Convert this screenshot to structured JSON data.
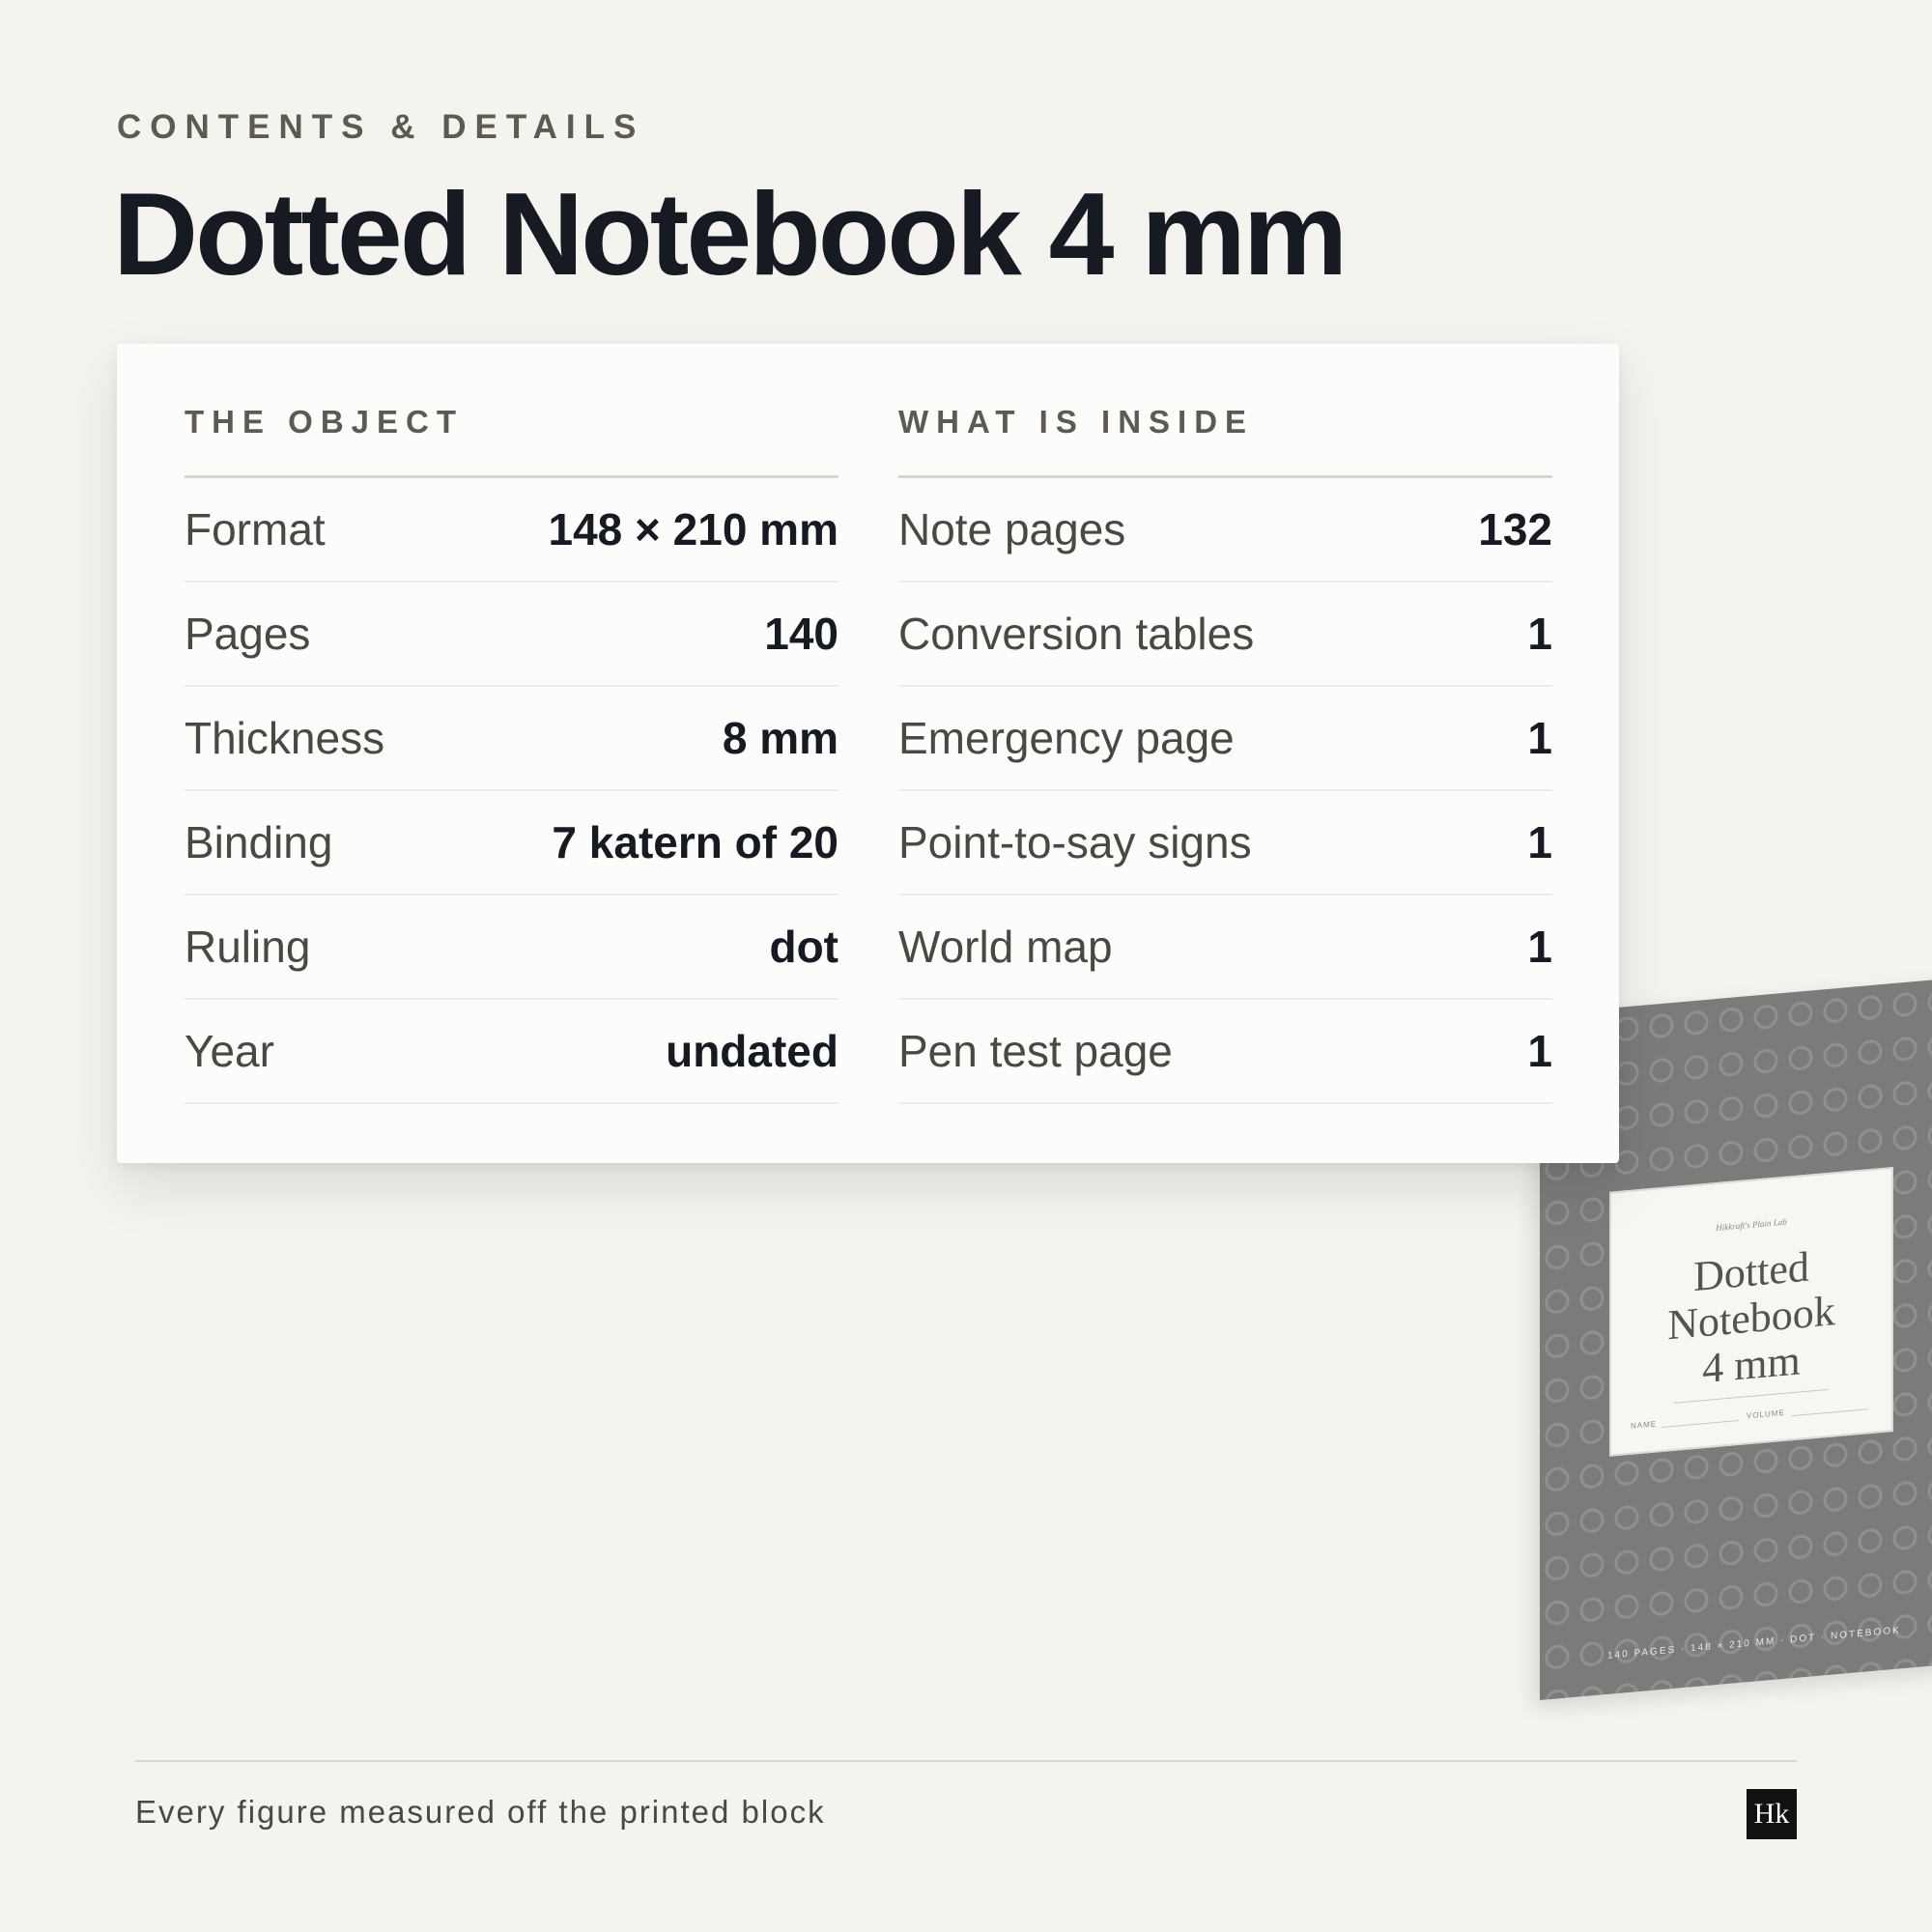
{
  "header": {
    "eyebrow": "CONTENTS & DETAILS",
    "title": "Dotted Notebook 4 mm"
  },
  "card": {
    "left_heading": "THE OBJECT",
    "right_heading": "WHAT IS INSIDE",
    "left_rows": [
      {
        "label": "Format",
        "value": "148 × 210 mm"
      },
      {
        "label": "Pages",
        "value": "140"
      },
      {
        "label": "Thickness",
        "value": "8 mm"
      },
      {
        "label": "Binding",
        "value": "7 katern of 20"
      },
      {
        "label": "Ruling",
        "value": "dot"
      },
      {
        "label": "Year",
        "value": "undated"
      }
    ],
    "right_rows": [
      {
        "label": "Note pages",
        "value": "132"
      },
      {
        "label": "Conversion tables",
        "value": "1"
      },
      {
        "label": "Emergency page",
        "value": "1"
      },
      {
        "label": "Point-to-say signs",
        "value": "1"
      },
      {
        "label": "World map",
        "value": "1"
      },
      {
        "label": "Pen test page",
        "value": "1"
      }
    ]
  },
  "notebook": {
    "kicker": "Hikkraft's Plain Lab",
    "title_line1": "Dotted",
    "title_line2": "Notebook",
    "title_line3": "4 mm",
    "name_label": "NAME",
    "volume_label": "VOLUME",
    "footer": "140 PAGES · 148 × 210 MM · DOT · NOTEBOOK",
    "cover_color": "#7b7b7a"
  },
  "footer": {
    "text": "Every figure measured off the printed block",
    "brand": "Hk"
  },
  "colors": {
    "background": "#f4f3ee",
    "title": "#161a22",
    "muted": "#5d5a52"
  }
}
